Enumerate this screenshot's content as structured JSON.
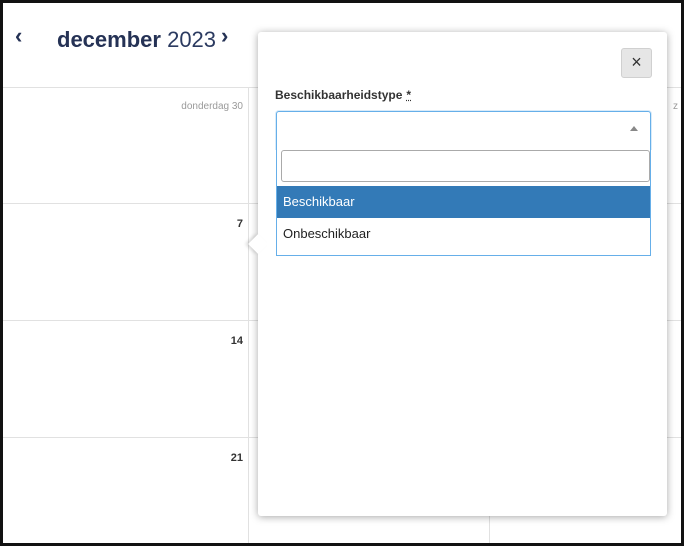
{
  "calendar": {
    "prev_icon": "chevron-left-icon",
    "prev_glyph": "‹",
    "next_icon": "chevron-right-icon",
    "next_glyph": "›",
    "month": "december",
    "year": "2023",
    "column_header_left": "donderdag 30",
    "column_header_right_fragment": "z",
    "day_numbers": [
      "7",
      "14",
      "21"
    ]
  },
  "popover": {
    "close_glyph": "×",
    "close_icon": "close-icon",
    "field_label": "Beschikbaarheidstype",
    "required_marker": "*",
    "select_value": "",
    "search_value": "",
    "options": [
      "Beschikbaar",
      "Onbeschikbaar"
    ],
    "highlighted_option": "Beschikbaar"
  },
  "colors": {
    "header_text": "#253255",
    "highlight": "#337ab7",
    "focus_border": "#66afe9"
  }
}
